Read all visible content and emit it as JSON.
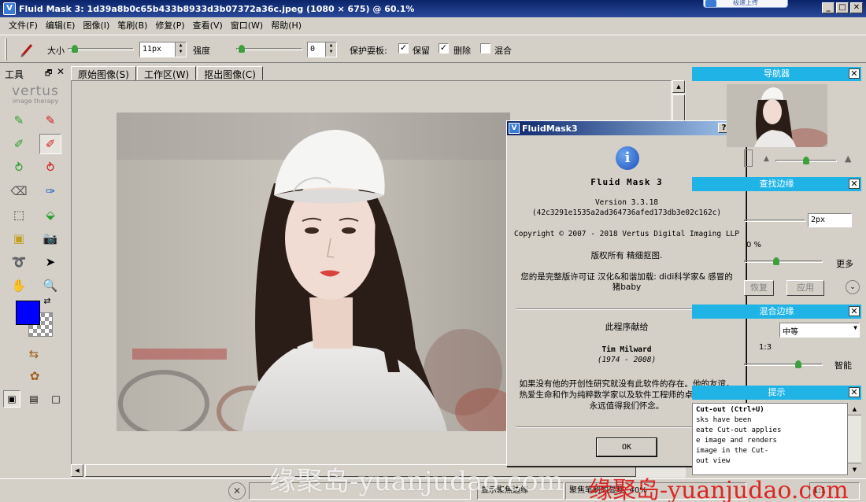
{
  "window": {
    "title": "Fluid Mask 3: 1d39a8b0c65b433b8933d3b07372a36c.jpeg (1080 × 675) @ 60.1%",
    "upload_label": "极速上传",
    "min": "_",
    "max": "□",
    "close": "✕"
  },
  "menu": [
    "文件(F)",
    "编辑(E)",
    "图像(I)",
    "笔刷(B)",
    "修复(P)",
    "查看(V)",
    "窗口(W)",
    "帮助(H)"
  ],
  "toolbar": {
    "size_label": "大小",
    "size_value": "11px",
    "size_level": 0.05,
    "strength_label": "强度",
    "strength_value": "0",
    "strength_level": 0.02,
    "protect_label": "保护耍板:",
    "keep_label": "保留",
    "keep_checked": "✓",
    "delete_label": "删除",
    "delete_checked": "✓",
    "mix_label": "混合",
    "mix_checked": ""
  },
  "left_panel": {
    "title": "工具",
    "pin": "🗗",
    "close": "✕",
    "logo": "vertus",
    "logo_sub": "image therapy",
    "foreground_color": "#0000ff"
  },
  "tabs": [
    "原始图像(S)",
    "工作区(W)",
    "抠出图像(C)"
  ],
  "dialog": {
    "title": "FluidMask3",
    "help": "?",
    "close": "✕",
    "app_name": "Fluid  Mask  3",
    "version": "Version 3.3.18",
    "hash": "(42c3291e1535a2ad364736afed173db3e02c162c)",
    "copyright": "Copyright © 2007 - 2018 Vertus Digital Imaging LLP",
    "rights": "版权所有 精细抠图.",
    "license": "您的是完整版许可证 汉化&和谐加载: didi科学家& 感冒的猪baby",
    "dedication": "此程序献给",
    "person": "Tim Milward",
    "years": "(1974 - 2008)",
    "tribute": "如果没有他的开创性研究就没有此软件的存在。他的友谊，热爱生命和作为纯粹数学家以及软件工程师的卓越才华，将永远值得我们怀念。",
    "ok": "OK"
  },
  "right_panel": {
    "navigator_title": "导航器",
    "find_edges_title": "查找边缘",
    "find_edges_value": "2px",
    "percent_label": "0 %",
    "more_label": "更多",
    "restore_label": "恢复",
    "apply_label": "应用",
    "blend_title": "混合边缘",
    "blend_value": "中等",
    "ratio_label": "1:3",
    "smart_label": "智能",
    "hint_title": "提示",
    "hint_lines": [
      "Cut-out (Ctrl+U)",
      "",
      "sks have been",
      "eate Cut-out applies",
      "e image and renders",
      " image in the Cut-",
      "out view"
    ]
  },
  "status": {
    "cancel": "✕",
    "field1": "",
    "field2": "显示聚焦边缘",
    "field3": "聚焦笔刷的显现: 40%",
    "field4": "1:1"
  },
  "watermark": {
    "light": "缘聚岛-yuanjudao.com",
    "red": "缘聚岛-yuanjudao.com"
  }
}
